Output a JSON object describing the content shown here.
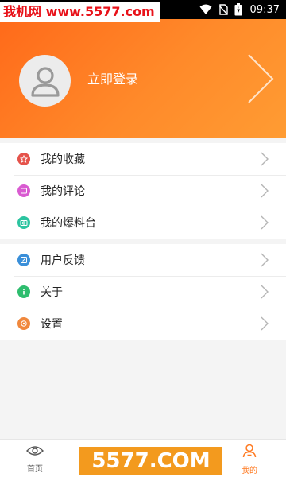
{
  "watermark_top": "我机网 www.5577.com",
  "watermark_bottom": "5577.COM",
  "status": {
    "time": "09:37",
    "icons": [
      "wifi-icon",
      "no-sim-icon",
      "battery-icon"
    ]
  },
  "header": {
    "login_label": "立即登录"
  },
  "menu_sections": [
    {
      "items": [
        {
          "label": "我的收藏",
          "icon": "favorite-icon",
          "color": "#e5534b"
        },
        {
          "label": "我的评论",
          "icon": "comment-icon",
          "color": "#d95bd1"
        },
        {
          "label": "我的爆料台",
          "icon": "camera-icon",
          "color": "#2cc4a0"
        }
      ]
    },
    {
      "items": [
        {
          "label": "用户反馈",
          "icon": "feedback-icon",
          "color": "#3a8fd9"
        },
        {
          "label": "关于",
          "icon": "info-icon",
          "color": "#2ebd6e"
        },
        {
          "label": "设置",
          "icon": "settings-icon",
          "color": "#f0883d"
        }
      ]
    }
  ],
  "tabbar": {
    "home_label": "首页",
    "mine_label": "我的",
    "active": "mine",
    "accent": "#ff7a22"
  }
}
